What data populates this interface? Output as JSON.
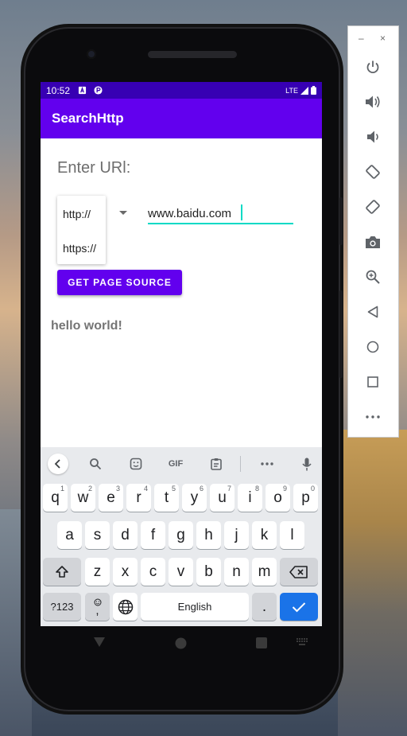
{
  "status_bar": {
    "time": "10:52",
    "network": "LTE"
  },
  "app_bar": {
    "title": "SearchHttp"
  },
  "form": {
    "label": "Enter URl:",
    "protocol_options": [
      "http://",
      "https://"
    ],
    "url_value": "www.baidu.com",
    "button_label": "GET PAGE SOURCE"
  },
  "result_text": "hello world!",
  "keyboard": {
    "toolbar": [
      "back",
      "search",
      "sticker",
      "GIF",
      "clipboard",
      "more",
      "mic"
    ],
    "row1": [
      [
        "q",
        "1"
      ],
      [
        "w",
        "2"
      ],
      [
        "e",
        "3"
      ],
      [
        "r",
        "4"
      ],
      [
        "t",
        "5"
      ],
      [
        "y",
        "6"
      ],
      [
        "u",
        "7"
      ],
      [
        "i",
        "8"
      ],
      [
        "o",
        "9"
      ],
      [
        "p",
        "0"
      ]
    ],
    "row2": [
      "a",
      "s",
      "d",
      "f",
      "g",
      "h",
      "j",
      "k",
      "l"
    ],
    "row3": [
      "z",
      "x",
      "c",
      "v",
      "b",
      "n",
      "m"
    ],
    "symbols_label": "?123",
    "comma_label": ",",
    "space_label": "English",
    "period_label": "."
  },
  "colors": {
    "status_bar": "#3700b3",
    "primary": "#6200ee",
    "accent": "#03dac5",
    "enter_key": "#1a73e8"
  },
  "emulator_toolbar": {
    "buttons": [
      "power",
      "volume-up",
      "volume-down",
      "rotate-left",
      "rotate-right",
      "screenshot",
      "zoom",
      "back",
      "home",
      "overview",
      "more"
    ]
  }
}
